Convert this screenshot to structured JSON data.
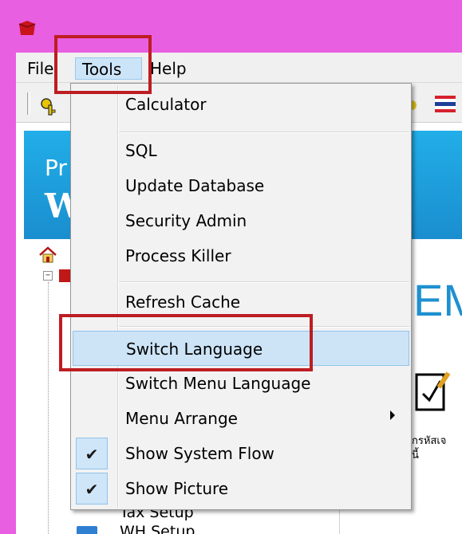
{
  "menubar": {
    "file_label": "File",
    "tools_label": "Tools",
    "help_label": "Help"
  },
  "banner": {
    "text_top": "Pr",
    "text_bottom": "W"
  },
  "tree": {
    "expander": "−",
    "items": [
      {
        "label": "Tax Setup"
      },
      {
        "label": "WH Setup"
      }
    ]
  },
  "content": {
    "big_letter": "EM",
    "thai_line1": "กรหัสเจ",
    "thai_line2": "นี้"
  },
  "tools_menu": {
    "items": [
      {
        "label": "Calculator"
      },
      {
        "label": "SQL"
      },
      {
        "label": "Update Database"
      },
      {
        "label": "Security Admin"
      },
      {
        "label": "Process Killer"
      },
      {
        "label": "Refresh Cache"
      },
      {
        "label": "Switch Language",
        "state": "hovered"
      },
      {
        "label": "Switch Menu Language"
      },
      {
        "label": "Menu Arrange",
        "has_submenu": true
      },
      {
        "label": "Show System Flow",
        "checked": true
      },
      {
        "label": "Show Picture",
        "checked": true
      }
    ],
    "check_glyph": "✔"
  },
  "colors": {
    "titlebar": "#e95fe1",
    "highlight_annotation": "#bd1d22",
    "menu_hover": "#cde4f7",
    "banner": "#1a8ecf"
  },
  "icons": [
    "app-icon",
    "key-icon",
    "language-flag-icon",
    "home-icon",
    "folder-icon",
    "edit-document-icon",
    "check-icon",
    "chevron-right-icon"
  ]
}
